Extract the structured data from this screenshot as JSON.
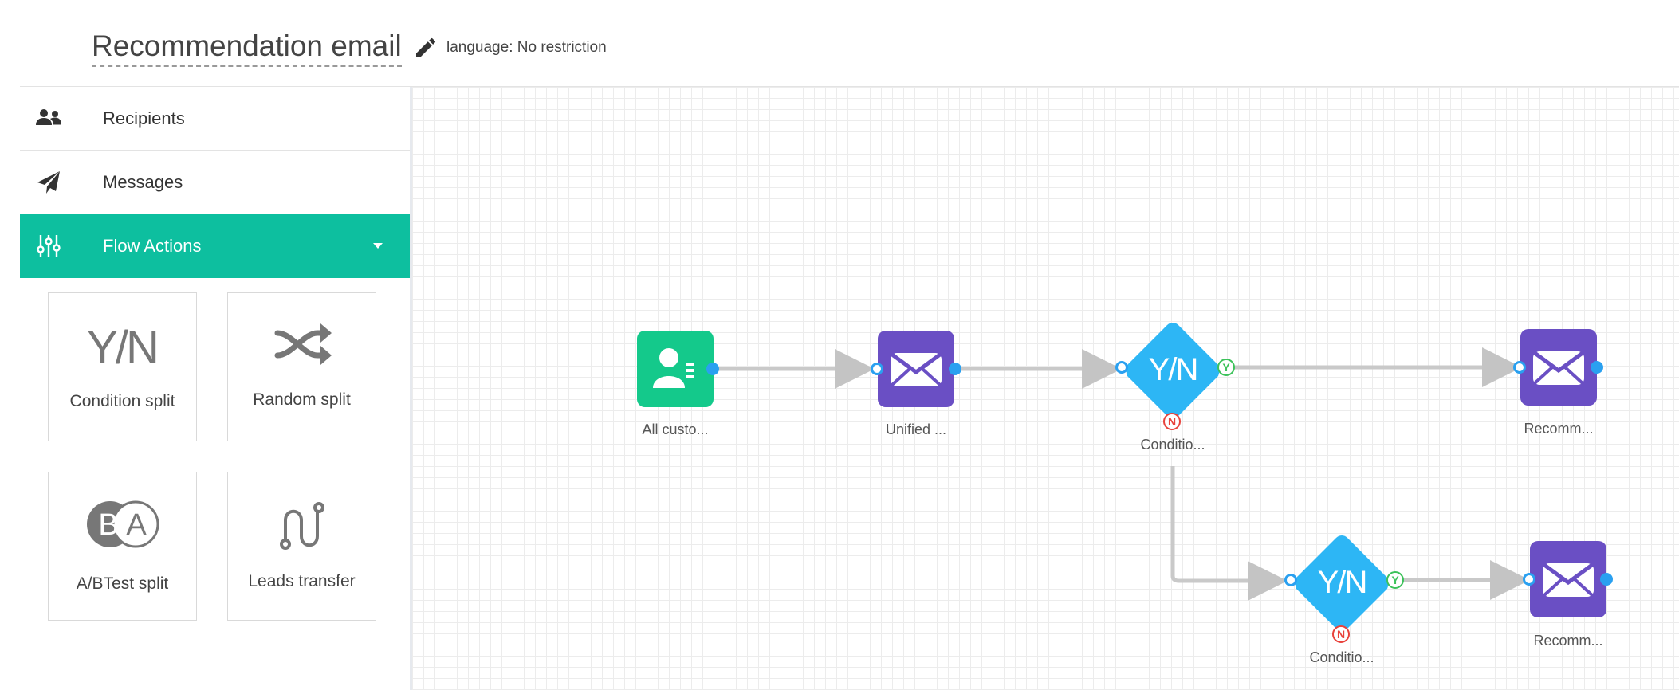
{
  "header": {
    "title": "Recommendation email",
    "language": "language: No restriction"
  },
  "sidebar": {
    "items": [
      {
        "label": "Recipients",
        "icon": "users-icon"
      },
      {
        "label": "Messages",
        "icon": "paper-plane-icon"
      },
      {
        "label": "Flow Actions",
        "icon": "sliders-icon",
        "active": true
      }
    ],
    "tiles": [
      {
        "label": "Condition split",
        "icon": "Y/N"
      },
      {
        "label": "Random split",
        "icon": "shuffle-icon"
      },
      {
        "label": "A/BTest split",
        "icon": "B A"
      },
      {
        "label": "Leads transfer",
        "icon": "route-icon"
      }
    ],
    "accent_color": "#0dbf9f"
  },
  "flow": {
    "nodes": [
      {
        "label": "All custo...",
        "type": "audience",
        "color": "#14c98b"
      },
      {
        "label": "Unified ...",
        "type": "email",
        "color": "#6a4fc4"
      },
      {
        "label": "Conditio...",
        "type": "condition",
        "symbol": "Y/N",
        "color": "#2db6f5"
      },
      {
        "label": "Recomm...",
        "type": "email",
        "color": "#6a4fc4"
      },
      {
        "label": "Conditio...",
        "type": "condition",
        "symbol": "Y/N",
        "color": "#2db6f5"
      },
      {
        "label": "Recomm...",
        "type": "email",
        "color": "#6a4fc4"
      }
    ],
    "yes_badge": "Y",
    "no_badge": "N"
  }
}
